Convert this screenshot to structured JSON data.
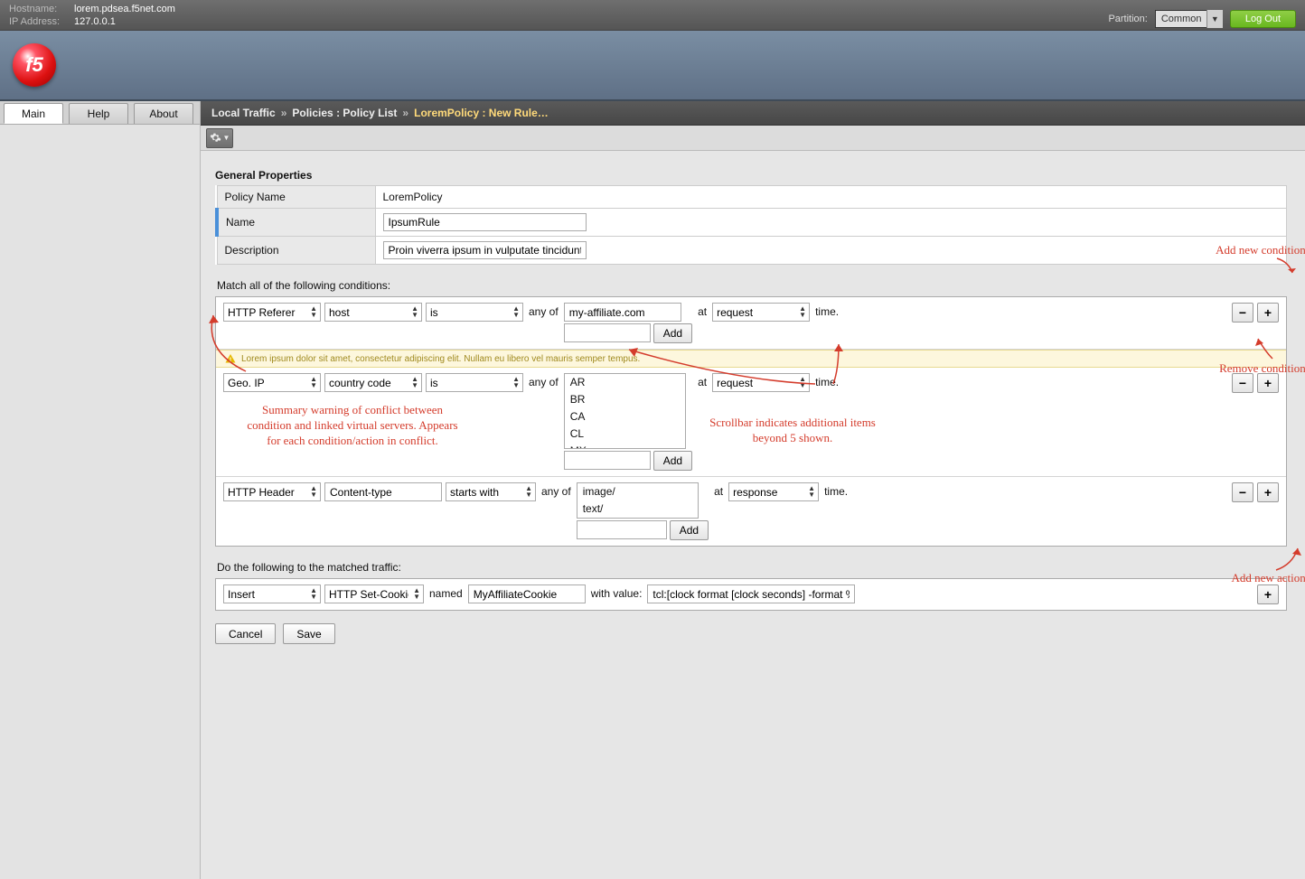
{
  "header": {
    "hostname_label": "Hostname:",
    "hostname": "lorem.pdsea.f5net.com",
    "ip_label": "IP Address:",
    "ip": "127.0.0.1",
    "partition_label": "Partition:",
    "partition_value": "Common",
    "logout": "Log Out"
  },
  "logo_text": "f5",
  "side_tabs": [
    "Main",
    "Help",
    "About"
  ],
  "breadcrumb": {
    "a": "Local Traffic",
    "b": "Policies : Policy List",
    "c": "LoremPolicy : New Rule…"
  },
  "section_general": "General Properties",
  "props": {
    "policy_name_label": "Policy Name",
    "policy_name": "LoremPolicy",
    "name_label": "Name",
    "name": "IpsumRule",
    "desc_label": "Description",
    "desc": "Proin viverra ipsum in vulputate tincidunt."
  },
  "cond_title": "Match all of the following conditions:",
  "cond1": {
    "operand": "HTTP Referer",
    "sub": "host",
    "cmp": "is",
    "anyof": "any of",
    "value": "my-affiliate.com",
    "at": "at",
    "event": "request",
    "time": "time.",
    "add": "Add"
  },
  "warning_text": "Lorem ipsum dolor sit amet, consectetur adipiscing elit. Nullam eu libero vel mauris semper tempus.",
  "cond2": {
    "operand": "Geo. IP",
    "sub": "country code",
    "cmp": "is",
    "anyof": "any of",
    "list": [
      "AR",
      "BR",
      "CA",
      "CL",
      "MX"
    ],
    "at": "at",
    "event": "request",
    "time": "time.",
    "add": "Add"
  },
  "cond3": {
    "operand": "HTTP Header",
    "subvalue": "Content-type",
    "cmp": "starts with",
    "anyof": "any of",
    "list": [
      "image/",
      "text/"
    ],
    "at": "at",
    "event": "response",
    "time": "time.",
    "add": "Add"
  },
  "act_title": "Do the following to the matched traffic:",
  "act1": {
    "verb": "Insert",
    "target": "HTTP Set-Cookie",
    "named": "named",
    "name": "MyAffiliateCookie",
    "withvalue": "with value:",
    "value": "tcl:[clock format [clock seconds] -format %H"
  },
  "buttons": {
    "cancel": "Cancel",
    "save": "Save"
  },
  "anno": {
    "add_cond": "Add new condition.",
    "remove_cond": "Remove condition.",
    "scrollbar": "Scrollbar indicates additional items\nbeyond 5 shown.",
    "warning": "Summary warning of conflict between\ncondition and linked virtual servers. Appears\nfor each condition/action in conflict.",
    "add_action": "Add new action."
  }
}
